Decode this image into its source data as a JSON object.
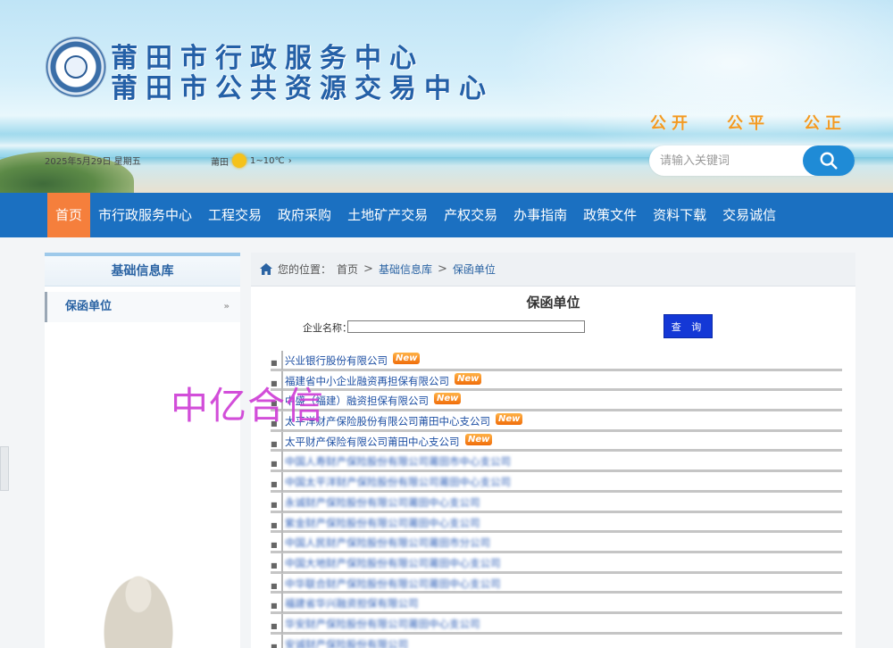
{
  "header": {
    "title_line1": "莆田市行政服务中心",
    "title_line2": "莆田市公共资源交易中心",
    "slogans": [
      "公开",
      "公平",
      "公正"
    ],
    "date": "2025年5月29日 星期五",
    "weather_city": "莆田",
    "weather_temp": "1~10℃"
  },
  "search": {
    "placeholder": "请输入关键词",
    "button_icon": "search-icon"
  },
  "nav": {
    "items": [
      "首页",
      "市行政服务中心",
      "工程交易",
      "政府采购",
      "土地矿产交易",
      "产权交易",
      "办事指南",
      "政策文件",
      "资料下载",
      "交易诚信"
    ],
    "active_index": 0,
    "bar_color": "#1b70c1",
    "active_color": "#f57f3c"
  },
  "sidebar": {
    "title": "基础信息库",
    "items": [
      {
        "label": "保函单位",
        "arrow": "»"
      }
    ]
  },
  "breadcrumb": {
    "home_icon": "home-icon",
    "prefix": "您的位置：",
    "items": [
      "首页",
      "基础信息库",
      "保函单位"
    ],
    "separator": ">"
  },
  "main": {
    "title": "保函单位",
    "form_label": "企业名称：",
    "form_value": "",
    "query_button": "查 询"
  },
  "list": {
    "new_badge": "New",
    "items": [
      {
        "name": "兴业银行股份有限公司",
        "new": true
      },
      {
        "name": "福建省中小企业融资再担保有限公司",
        "new": true
      },
      {
        "name": "中盛（福建）融资担保有限公司",
        "new": true
      },
      {
        "name": "太平洋财产保险股份有限公司莆田中心支公司",
        "new": true
      },
      {
        "name": "太平财产保险有限公司莆田中心支公司",
        "new": true
      },
      {
        "name": "中国人寿财产保险股份有限公司莆田市中心支公司",
        "new": false
      },
      {
        "name": "中国太平洋财产保险股份有限公司莆田中心支公司",
        "new": false
      },
      {
        "name": "永诚财产保险股份有限公司莆田中心支公司",
        "new": false
      },
      {
        "name": "紫金财产保险股份有限公司莆田中心支公司",
        "new": false
      },
      {
        "name": "中国人民财产保险股份有限公司莆田市分公司",
        "new": false
      },
      {
        "name": "中国大地财产保险股份有限公司莆田中心支公司",
        "new": false
      },
      {
        "name": "中华联合财产保险股份有限公司莆田中心支公司",
        "new": false
      },
      {
        "name": "福建省华兴融资担保有限公司",
        "new": false
      },
      {
        "name": "华安财产保险股份有限公司莆田中心支公司",
        "new": false
      },
      {
        "name": "安诚财产保险股份有限公司",
        "new": false
      }
    ]
  },
  "watermark": "中亿合信"
}
